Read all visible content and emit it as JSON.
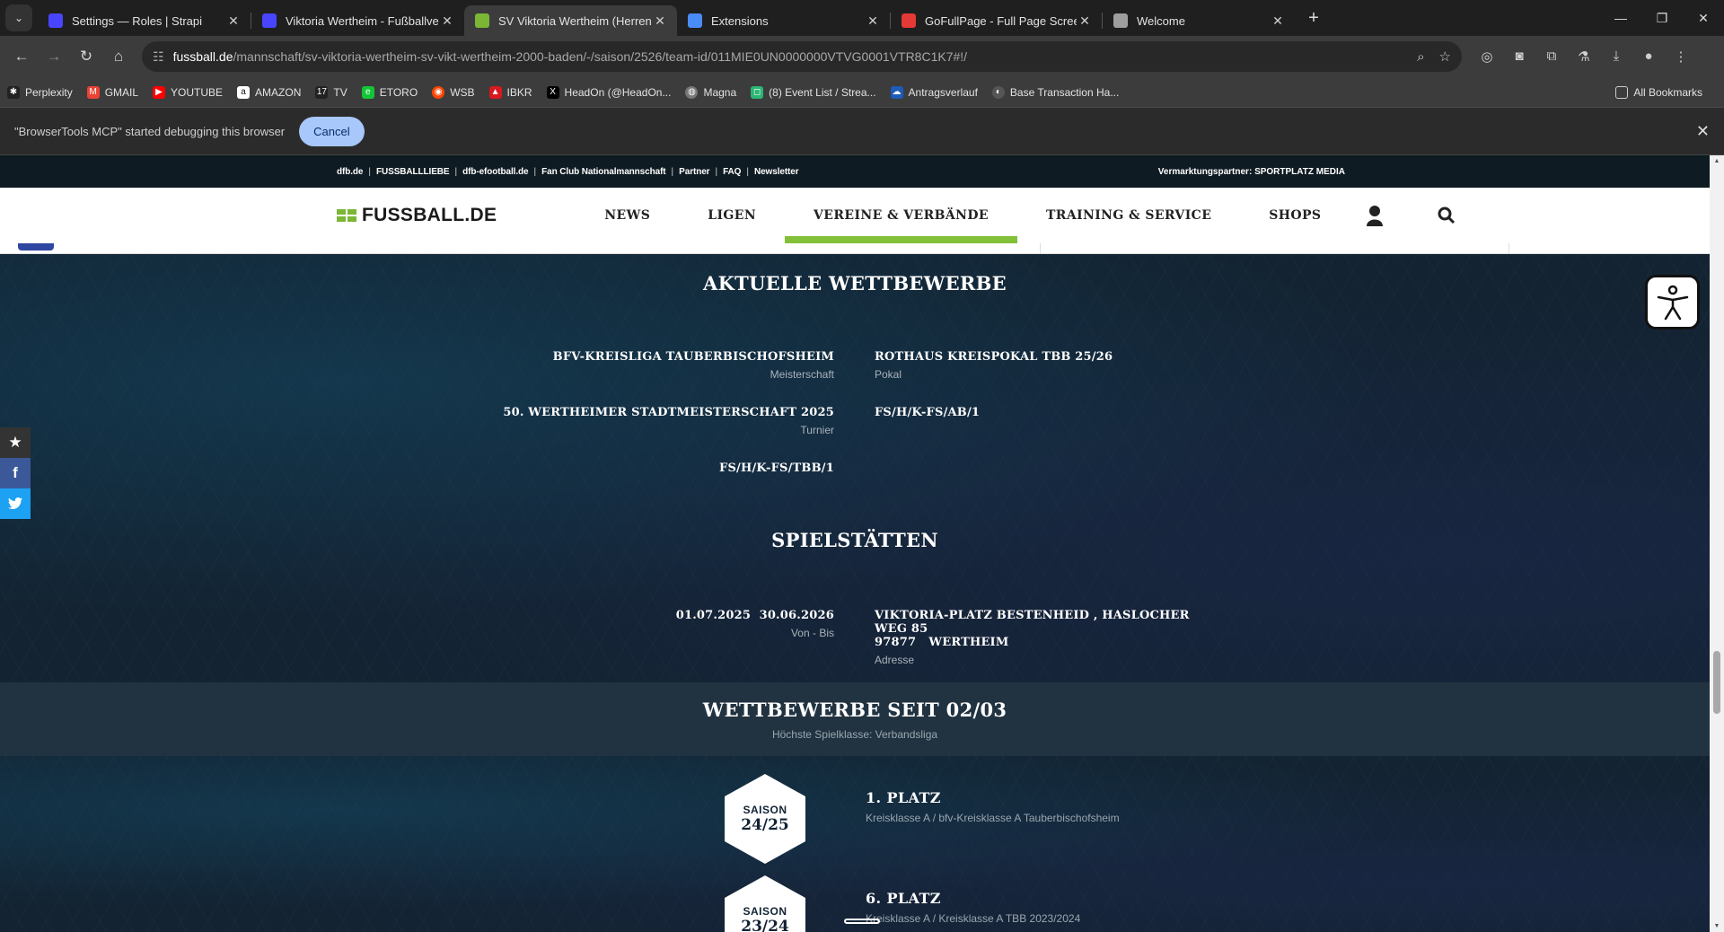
{
  "browser": {
    "tabs": [
      {
        "title": "Settings — Roles | Strapi",
        "color": "#4945ff"
      },
      {
        "title": "Viktoria Wertheim - Fußballverein",
        "color": "#4945ff"
      },
      {
        "title": "SV Viktoria Wertheim (Herren)",
        "color": "#7bb735",
        "active": true
      },
      {
        "title": "Extensions",
        "color": "#4a8cf7"
      },
      {
        "title": "GoFullPage - Full Page Screen Capture",
        "color": "#e53935"
      },
      {
        "title": "Welcome",
        "color": "#9e9e9e"
      }
    ],
    "url_host": "fussball.de",
    "url_path": "/mannschaft/sv-viktoria-wertheim-sv-vikt-wertheim-2000-baden/-/saison/2526/team-id/011MIE0UN0000000VTVG0001VTR8C1K7#!/",
    "bookmarks": [
      {
        "label": "Perplexity",
        "color": "#222"
      },
      {
        "label": "GMAIL",
        "color": "#ea4335"
      },
      {
        "label": "YOUTUBE",
        "color": "#ff0000"
      },
      {
        "label": "AMAZON",
        "color": "#333"
      },
      {
        "label": "TV",
        "color": "#222"
      },
      {
        "label": "ETORO",
        "color": "#13c636"
      },
      {
        "label": "WSB",
        "color": "#ff4500"
      },
      {
        "label": "IBKR",
        "color": "#d71920"
      },
      {
        "label": "HeadOn (@HeadOn...",
        "color": "#000"
      },
      {
        "label": "Magna",
        "color": "#777"
      },
      {
        "label": "(8) Event List / Strea...",
        "color": "#2bb673"
      },
      {
        "label": "Antragsverlauf",
        "color": "#1e5bb8"
      },
      {
        "label": "Base Transaction Ha...",
        "color": "#555"
      }
    ],
    "all_bookmarks": "All Bookmarks",
    "infobar": {
      "message": "\"BrowserTools MCP\" started debugging this browser",
      "cancel": "Cancel"
    }
  },
  "site": {
    "meta_links": [
      "dfb.de",
      "FUSSBALLLIEBE",
      "dfb-efootball.de",
      "Fan Club Nationalmannschaft",
      "Partner",
      "FAQ",
      "Newsletter"
    ],
    "partner_label": "Vermarktungspartner:",
    "partner_name": "SPORTPLATZ MEDIA",
    "logo": "FUSSBALL.DE",
    "nav": [
      "NEWS",
      "LIGEN",
      "VEREINE & VERBÄNDE",
      "TRAINING & SERVICE",
      "SHOPS"
    ],
    "active_nav": "VEREINE & VERBÄNDE"
  },
  "competitions": {
    "title": "AKTUELLE WETTBEWERBE",
    "items": [
      {
        "name": "BFV-KREISLIGA TAUBERBISCHOFSHEIM",
        "type": "Meisterschaft"
      },
      {
        "name": "ROTHAUS KREISPOKAL TBB 25/26",
        "type": "Pokal"
      },
      {
        "name": "50. WERTHEIMER STADTMEISTERSCHAFT 2025",
        "type": "Turnier"
      },
      {
        "name": "FS/H/K-FS/AB/1",
        "type": ""
      },
      {
        "name": "FS/H/K-FS/TBB/1",
        "type": ""
      }
    ]
  },
  "venues": {
    "title": "SPIELSTÄTTEN",
    "dates": "01.07.2025  30.06.2026",
    "dates_label": "Von - Bis",
    "address_line1": "VIKTORIA-PLATZ BESTENHEID , HASLOCHER WEG 85",
    "address_line2": "97877   WERTHEIM",
    "address_label": "Adresse"
  },
  "history": {
    "title": "WETTBEWERBE SEIT 02/03",
    "subtitle": "Höchste Spielklasse: Verbandsliga",
    "seasons": [
      {
        "label": "SAISON",
        "season": "24/25",
        "place": "1. PLATZ",
        "league": "Kreisklasse A / bfv-Kreisklasse A Tauberbischofsheim"
      },
      {
        "label": "SAISON",
        "season": "23/24",
        "place": "6. PLATZ",
        "league": "Kreisklasse A / Kreisklasse A TBB 2023/2024"
      }
    ]
  }
}
